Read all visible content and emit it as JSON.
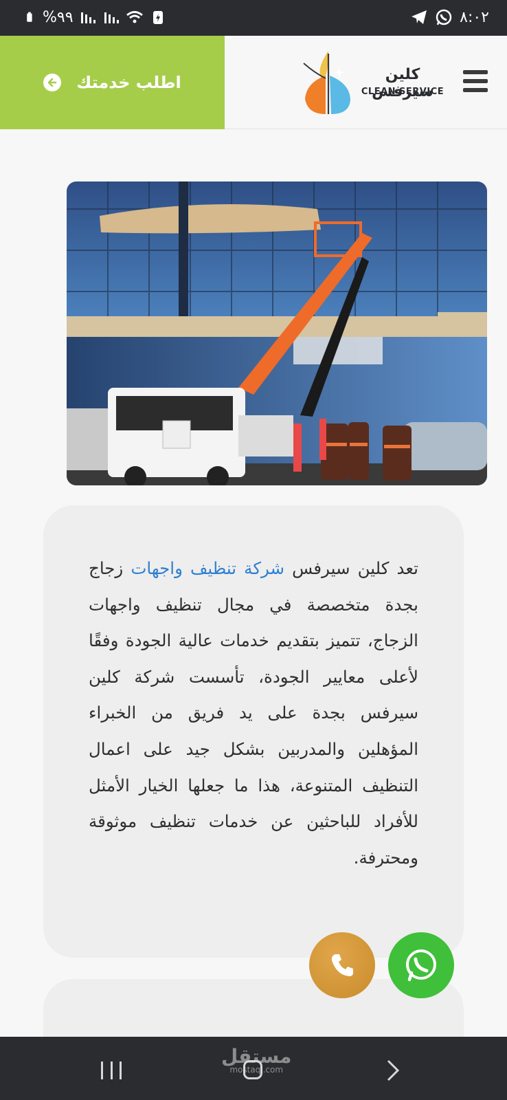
{
  "status_bar": {
    "time": "٨:٠٢",
    "battery_percent": "%٩٩",
    "icons": [
      "whatsapp-icon",
      "telegram-icon",
      "battery-saver-icon",
      "wifi-icon",
      "signal-icon",
      "signal-icon",
      "battery-icon"
    ]
  },
  "header": {
    "cta_label": "اطلب خدمتك",
    "logo_ar": "كلين سيرفس",
    "logo_en": "CLEAN SERVICE",
    "colors": {
      "cta_bg": "#a6cd4a",
      "menu_icon": "#3a3a3a"
    }
  },
  "hero": {
    "image_description_icon": "building-glass-cleaning-photo"
  },
  "intro_card": {
    "text_before": "تعد كلين سيرفس ",
    "link_text": "شركة تنظيف واجهات",
    "text_after": " زجاج بجدة متخصصة في مجال تنظيف واجهات الزجاج، تتميز بتقديم خدمات عالية الجودة وفقًا لأعلى معايير الجودة، تأسست شركة كلين سيرفس بجدة على يد فريق من الخبراء المؤهلين والمدربين بشكل جيد على اعمال التنظيف المتنوعة، هذا ما جعلها الخيار الأمثل للأفراد للباحثين عن خدمات تنظيف موثوقة ومحترفة."
  },
  "fabs": {
    "phone": "phone-icon",
    "whatsapp": "whatsapp-icon",
    "colors": {
      "phone": "#d69b3d",
      "whatsapp": "#3fbf3a"
    }
  },
  "nav_bar": {
    "watermark_ar": "مستقل",
    "watermark_en": "mostaql.com"
  }
}
